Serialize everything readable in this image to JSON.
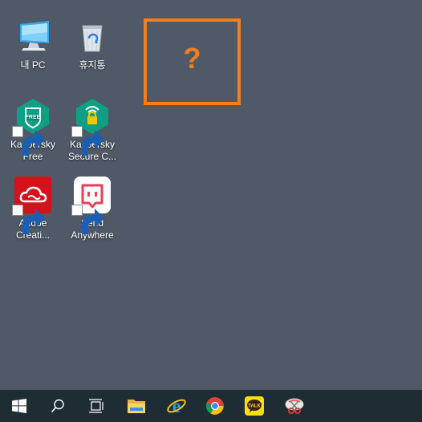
{
  "desktop": {
    "icons": [
      {
        "id": "this-pc",
        "label": "내 PC"
      },
      {
        "id": "recycle-bin",
        "label": "휴지통"
      },
      {
        "id": "kaspersky-free",
        "label": "Kaspersky Free"
      },
      {
        "id": "kaspersky-secure",
        "label": "Kaspersky Secure C..."
      },
      {
        "id": "adobe-creative",
        "label": "Adobe Creati..."
      },
      {
        "id": "send-anywhere",
        "label": "Send Anywhere"
      }
    ],
    "unknown_placeholder": "?"
  },
  "taskbar": {
    "items": [
      "start-icon",
      "search-icon",
      "task-view-icon",
      "file-explorer-icon",
      "internet-explorer-icon",
      "chrome-icon",
      "kakaotalk-icon",
      "snipping-tool-icon"
    ],
    "kakaotalk_badge": "TALK"
  },
  "colors": {
    "desktop_bg": "#4f5967",
    "taskbar_bg": "#1e2c34",
    "accent_orange": "#f07f21",
    "kaspersky_green": "#0e9f84",
    "adobe_red": "#d4121b",
    "send_anywhere_pink": "#ee3d5a"
  }
}
